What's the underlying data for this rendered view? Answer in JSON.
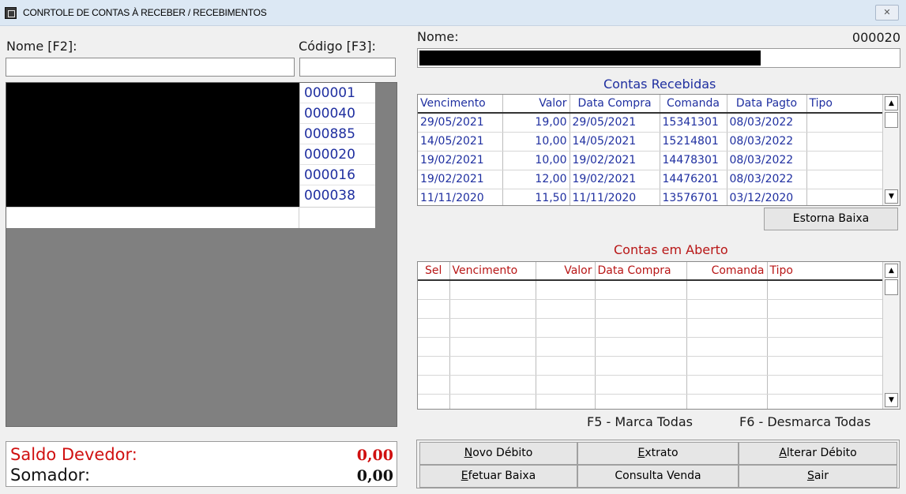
{
  "window": {
    "title": "CONRTOLE DE CONTAS À RECEBER / RECEBIMENTOS",
    "close_glyph": "✕"
  },
  "left": {
    "nome_label": "Nome [F2]:",
    "codigo_label": "Código [F3]:",
    "nome_value": "",
    "codigo_value": "",
    "codes": [
      "000001",
      "000040",
      "000885",
      "000020",
      "000016",
      "000038"
    ]
  },
  "totals": {
    "saldo_label": "Saldo Devedor:",
    "saldo_value": "0,00",
    "somador_label": "Somador:",
    "somador_value": "0,00"
  },
  "right": {
    "nome_label": "Nome:",
    "client_code": "000020"
  },
  "recebidas": {
    "title": "Contas Recebidas",
    "columns": [
      "Vencimento",
      "Valor",
      "Data Compra",
      "Comanda",
      "Data Pagto",
      "Tipo"
    ],
    "rows": [
      [
        "29/05/2021",
        "19,00",
        "29/05/2021",
        "15341301",
        "08/03/2022",
        ""
      ],
      [
        "14/05/2021",
        "10,00",
        "14/05/2021",
        "15214801",
        "08/03/2022",
        ""
      ],
      [
        "19/02/2021",
        "10,00",
        "19/02/2021",
        "14478301",
        "08/03/2022",
        ""
      ],
      [
        "19/02/2021",
        "12,00",
        "19/02/2021",
        "14476201",
        "08/03/2022",
        ""
      ],
      [
        "11/11/2020",
        "11,50",
        "11/11/2020",
        "13576701",
        "03/12/2020",
        ""
      ]
    ],
    "estorna_button": "Estorna Baixa"
  },
  "aberto": {
    "title": "Contas em Aberto",
    "columns": [
      "Sel",
      "Vencimento",
      "Valor",
      "Data Compra",
      "Comanda",
      "Tipo"
    ],
    "empty_rows": 6
  },
  "hints": {
    "f5": "F5 - Marca Todas",
    "f6": "F6 - Desmarca Todas"
  },
  "buttons": {
    "novo_debito": {
      "key": "N",
      "rest": "ovo Débito"
    },
    "extrato": {
      "key": "E",
      "rest": "xtrato"
    },
    "alterar_debito": {
      "key": "A",
      "rest": "lterar Débito"
    },
    "efetuar_baixa": {
      "key": "E",
      "rest": "fetuar Baixa"
    },
    "consulta_venda": "Consulta Venda",
    "sair": {
      "key": "S",
      "rest": "air"
    }
  },
  "icons": {
    "app": "window-app-icon",
    "close": "close-icon",
    "scroll_up": "▲",
    "scroll_down": "▼"
  },
  "colors": {
    "blue_text": "#1f2fa0",
    "red_text": "#d01010",
    "section_red": "#b81616",
    "grid_gray": "#808080"
  }
}
